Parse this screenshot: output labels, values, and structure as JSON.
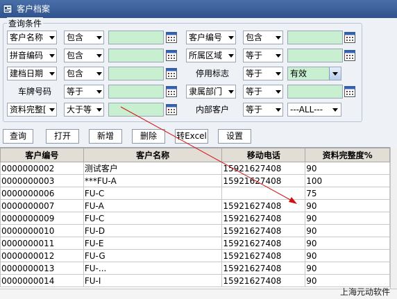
{
  "window": {
    "title": "客户档案"
  },
  "filter": {
    "group_title": "查询条件",
    "rows": [
      {
        "left": {
          "field": "客户名称",
          "op": "包含"
        },
        "right": {
          "field": "客户编号",
          "op": "包含"
        }
      },
      {
        "left": {
          "field": "拼音编码",
          "op": "包含"
        },
        "right": {
          "field": "所属区域",
          "op": "等于"
        }
      },
      {
        "left": {
          "field": "建档日期",
          "op": "包含"
        },
        "right": {
          "field": "停用标志",
          "op": "等于",
          "value": "有效"
        }
      },
      {
        "left": {
          "field": "车牌号码",
          "op": "等于"
        },
        "right": {
          "field": "隶属部门",
          "op": "等于"
        }
      },
      {
        "left": {
          "field": "资料完整[",
          "op": "大于等"
        },
        "right": {
          "field": "内部客户",
          "op": "等于",
          "value": "---ALL---"
        }
      }
    ]
  },
  "toolbar": {
    "query": "查询",
    "open": "打开",
    "add": "新增",
    "delete": "删除",
    "excel": "转Excel",
    "settings": "设置"
  },
  "table": {
    "columns": [
      "客户编号",
      "客户名称",
      "移动电话",
      "资料完整度%"
    ],
    "rows": [
      [
        "0000000002",
        "测试客户",
        "15921627408",
        "90"
      ],
      [
        "0000000003",
        "***FU-A",
        "15921627408",
        "100"
      ],
      [
        "0000000006",
        "FU-C",
        "",
        "75"
      ],
      [
        "0000000007",
        "FU-A",
        "15921627408",
        "90"
      ],
      [
        "0000000009",
        "FU-C",
        "15921627408",
        "90"
      ],
      [
        "0000000010",
        "FU-D",
        "15921627408",
        "90"
      ],
      [
        "0000000011",
        "FU-E",
        "15921627408",
        "90"
      ],
      [
        "0000000012",
        "FU-G",
        "15921627408",
        "90"
      ],
      [
        "0000000013",
        "FU-...",
        "15921627408",
        "90"
      ],
      [
        "0000000014",
        "FU-I",
        "15921627408",
        "90"
      ]
    ]
  },
  "watermark": "上海元动软件",
  "colors": {
    "titlebar": "#2f528c",
    "input_bg": "#c8f0d0",
    "annotation_arrow": "#d21010"
  }
}
